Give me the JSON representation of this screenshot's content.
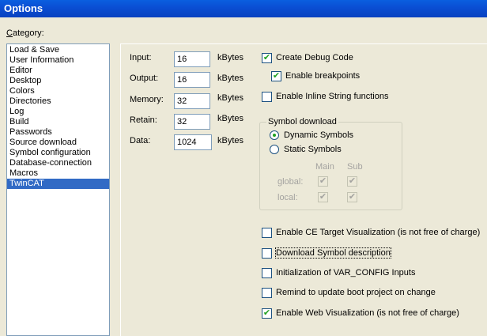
{
  "window": {
    "title": "Options"
  },
  "category": {
    "label": "Category:",
    "items": [
      "Load & Save",
      "User Information",
      "Editor",
      "Desktop",
      "Colors",
      "Directories",
      "Log",
      "Build",
      "Passwords",
      "Source download",
      "Symbol configuration",
      "Database-connection",
      "Macros",
      "TwinCAT"
    ],
    "selected": "TwinCAT"
  },
  "memory": {
    "unit": "kBytes",
    "fields": [
      {
        "label": "Input:",
        "value": "16"
      },
      {
        "label": "Output:",
        "value": "16"
      },
      {
        "label": "Memory:",
        "value": "32"
      },
      {
        "label": "Retain:",
        "value": "32"
      },
      {
        "label": "Data:",
        "value": "1024"
      }
    ]
  },
  "options": {
    "create_debug": {
      "label": "Create Debug Code",
      "checked": true
    },
    "enable_breakpoints": {
      "label": "Enable breakpoints",
      "checked": true
    },
    "inline_string": {
      "label": "Enable Inline String functions",
      "checked": false
    },
    "ce_target_vis": {
      "label": "Enable CE Target Visualization (is not free of charge)",
      "checked": false
    },
    "download_symbol_desc": {
      "label": "Download Symbol description",
      "checked": false
    },
    "init_var_config": {
      "label": "Initialization of VAR_CONFIG Inputs",
      "checked": false
    },
    "remind_boot": {
      "label": "Remind to update boot project on change",
      "checked": false
    },
    "web_vis": {
      "label": "Enable Web Visualization (is not free of charge)",
      "checked": true
    }
  },
  "symbol_download": {
    "title": "Symbol download",
    "dynamic": {
      "label": "Dynamic Symbols",
      "selected": true
    },
    "static": {
      "label": "Static Symbols",
      "selected": false
    },
    "col_main": "Main",
    "col_sub": "Sub",
    "row_global": "global:",
    "row_local": "local:"
  },
  "icons": {
    "check": "check-mark-icon"
  }
}
